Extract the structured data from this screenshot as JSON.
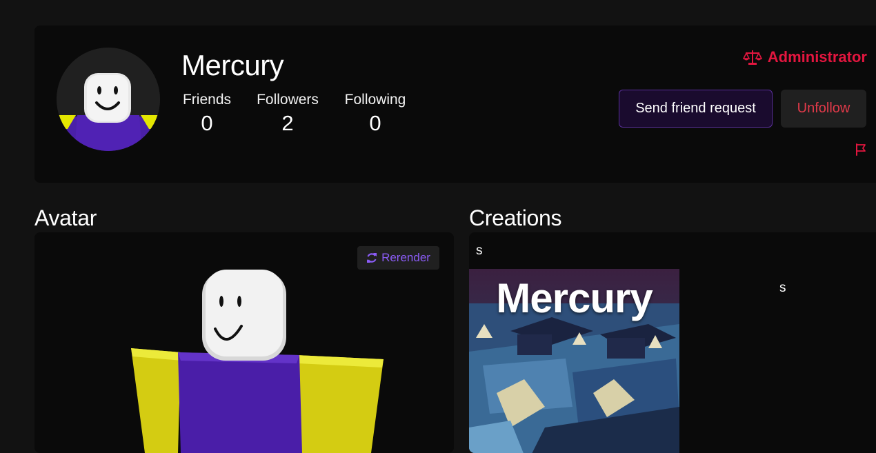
{
  "profile": {
    "username": "Mercury",
    "role": "Administrator",
    "stats": [
      {
        "label": "Friends",
        "value": "0"
      },
      {
        "label": "Followers",
        "value": "2"
      },
      {
        "label": "Following",
        "value": "0"
      }
    ],
    "actions": {
      "friend_request_label": "Send friend request",
      "unfollow_label": "Unfollow"
    }
  },
  "avatar_section": {
    "heading": "Avatar",
    "rerender_label": "Rerender"
  },
  "creations_section": {
    "heading": "Creations",
    "items": [
      {
        "title": "s",
        "thumbnail_text": "Mercury"
      },
      {
        "title": "s"
      }
    ]
  },
  "colors": {
    "accent_purple": "#8b5cf6",
    "admin_red": "#e3163f",
    "unfollow_red": "#e33a4a",
    "avatar_torso": "#4a20a8",
    "avatar_arms": "#c8c00f"
  },
  "icons": {
    "role": "scale-balance-icon",
    "rerender": "refresh-icon",
    "report": "flag-icon"
  }
}
